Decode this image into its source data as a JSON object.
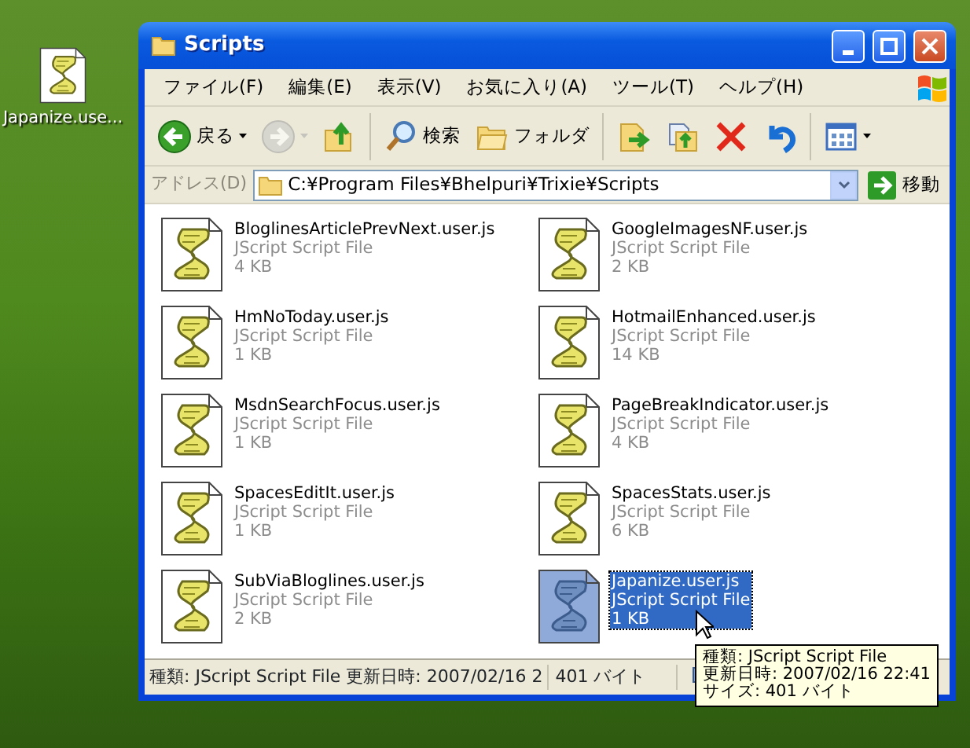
{
  "desktop_icons": [
    {
      "label": "Japanize.use..."
    }
  ],
  "window": {
    "title": "Scripts"
  },
  "menu": [
    "ファイル(F)",
    "編集(E)",
    "表示(V)",
    "お気に入り(A)",
    "ツール(T)",
    "ヘルプ(H)"
  ],
  "toolbar": [
    {
      "kind": "back",
      "label": "戻る",
      "disabled": false
    },
    {
      "kind": "forward",
      "disabled": true
    },
    {
      "kind": "up",
      "disabled": false
    },
    {
      "kind": "search",
      "label": "検索",
      "disabled": false
    },
    {
      "kind": "folders",
      "label": "フォルダ",
      "disabled": false
    },
    {
      "kind": "move",
      "disabled": false
    },
    {
      "kind": "copy",
      "disabled": false
    },
    {
      "kind": "delete",
      "disabled": false
    },
    {
      "kind": "undo",
      "disabled": false
    },
    {
      "kind": "views",
      "disabled": false
    }
  ],
  "address": {
    "label": "アドレス(D)",
    "value": "C:¥Program Files¥Bhelpuri¥Trixie¥Scripts",
    "go": "移動"
  },
  "files": [
    {
      "name": "BloglinesArticlePrevNext.user.js",
      "type": "JScript Script File",
      "size": "4 KB",
      "selected": false
    },
    {
      "name": "GoogleImagesNF.user.js",
      "type": "JScript Script File",
      "size": "2 KB",
      "selected": false
    },
    {
      "name": "HmNoToday.user.js",
      "type": "JScript Script File",
      "size": "1 KB",
      "selected": false
    },
    {
      "name": "HotmailEnhanced.user.js",
      "type": "JScript Script File",
      "size": "14 KB",
      "selected": false
    },
    {
      "name": "MsdnSearchFocus.user.js",
      "type": "JScript Script File",
      "size": "1 KB",
      "selected": false
    },
    {
      "name": "PageBreakIndicator.user.js",
      "type": "JScript Script File",
      "size": "4 KB",
      "selected": false
    },
    {
      "name": "SpacesEditIt.user.js",
      "type": "JScript Script File",
      "size": "1 KB",
      "selected": false
    },
    {
      "name": "SpacesStats.user.js",
      "type": "JScript Script File",
      "size": "6 KB",
      "selected": false
    },
    {
      "name": "SubViaBloglines.user.js",
      "type": "JScript Script File",
      "size": "2 KB",
      "selected": false
    },
    {
      "name": "Japanize.user.js",
      "type": "JScript Script File",
      "size": "1 KB",
      "selected": true
    }
  ],
  "status_bar": {
    "details": "種類: JScript Script File 更新日時: 2007/02/16 2",
    "size": "401 バイト"
  },
  "tooltip": {
    "lines": [
      "種類: JScript Script File",
      "更新日時: 2007/02/16 22:41",
      "サイズ: 401 バイト"
    ]
  }
}
